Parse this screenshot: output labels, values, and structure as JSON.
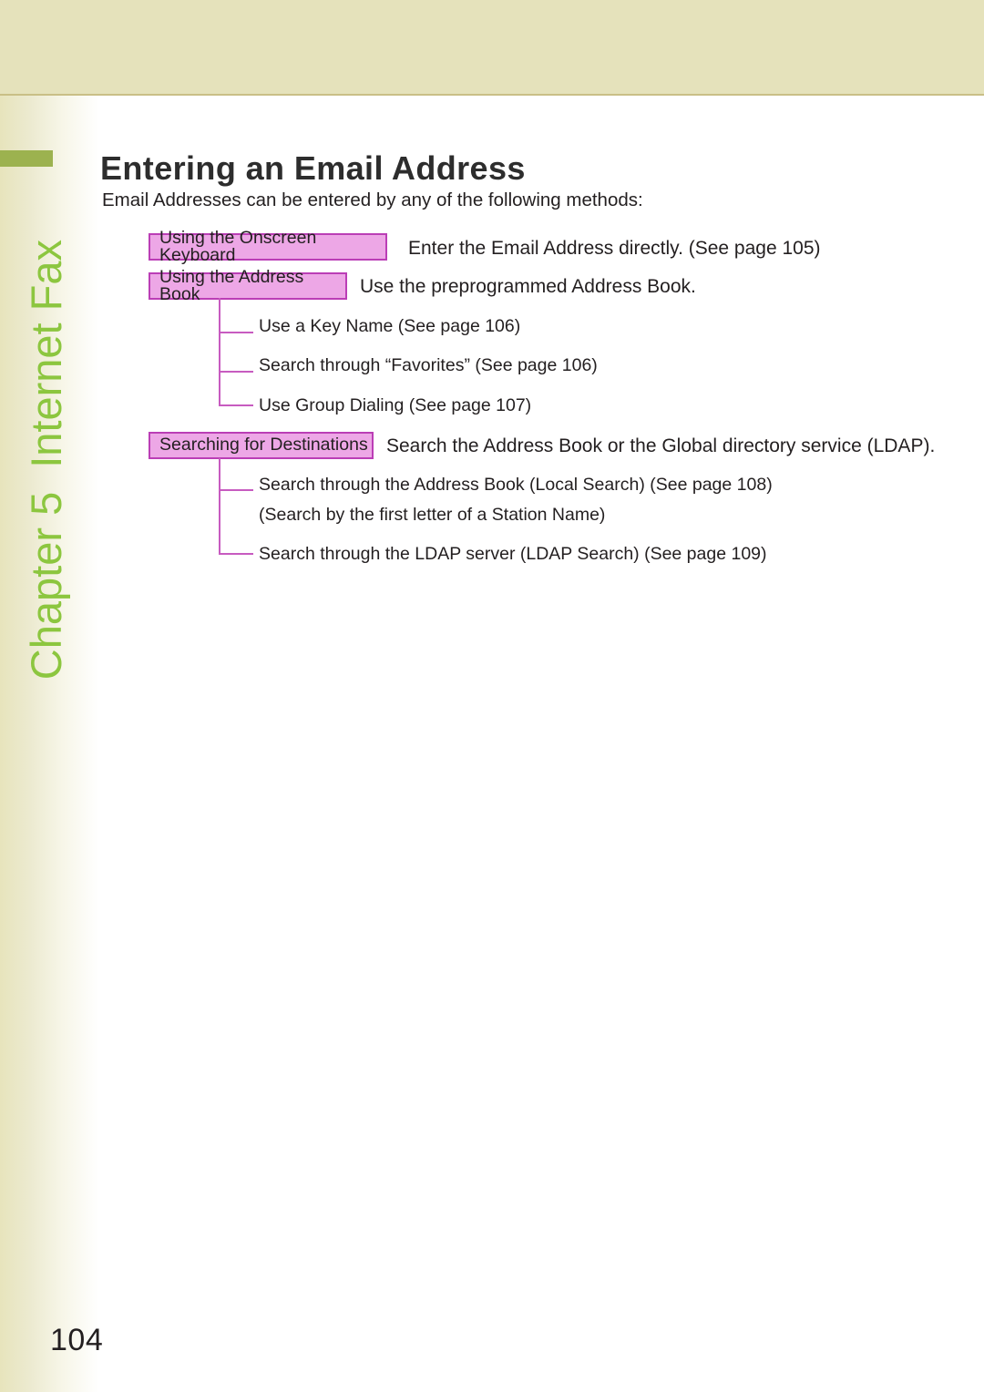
{
  "page": {
    "number": "104",
    "title": "Entering an Email Address",
    "intro": "Email Addresses can be entered by any of the following methods:"
  },
  "sidebar": {
    "chapter": "Chapter 5",
    "section": "Internet Fax",
    "accent_color": "#8cc63f",
    "tab_color": "#9cb24f",
    "band_color": "#e5e2bb"
  },
  "methods": [
    {
      "label": "Using the Onscreen Keyboard",
      "description": "Enter the Email Address directly. (See page 105)",
      "sub_items": []
    },
    {
      "label": "Using the Address Book",
      "description": "Use the preprogrammed Address Book.",
      "sub_items": [
        "Use a Key Name (See page 106)",
        "Search through “Favorites” (See page 106)",
        "Use Group Dialing (See page 107)"
      ]
    },
    {
      "label": "Searching for Destinations",
      "description": "Search the Address Book or the Global directory service (LDAP).",
      "sub_items": [
        "Search through the Address Book (Local Search) (See page 108)",
        "(Search by the first letter of a Station Name)",
        "Search through the LDAP server (LDAP Search) (See page 109)"
      ]
    }
  ],
  "colors": {
    "box_fill": "#eda7e6",
    "box_border": "#bb3eb6",
    "connector": "#c75bc0",
    "text": "#231f20"
  }
}
